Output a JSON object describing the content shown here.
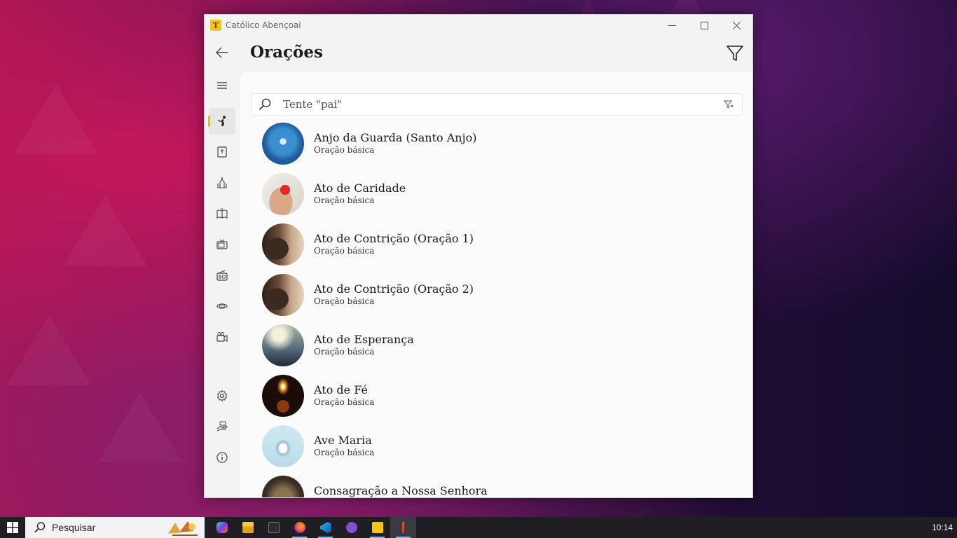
{
  "window": {
    "title": "Católico Abençoai"
  },
  "header": {
    "page_title": "Orações"
  },
  "search": {
    "placeholder": "Tente \"pai\""
  },
  "nav_rail": {
    "items": [
      {
        "name": "menu",
        "icon": "hamburger-icon"
      },
      {
        "name": "prayers",
        "icon": "praying-person-icon",
        "active": true
      },
      {
        "name": "bible",
        "icon": "bible-icon"
      },
      {
        "name": "church",
        "icon": "church-icon"
      },
      {
        "name": "liturgy",
        "icon": "book-icon"
      },
      {
        "name": "tv",
        "icon": "tv-icon"
      },
      {
        "name": "radio",
        "icon": "radio-icon"
      },
      {
        "name": "saints",
        "icon": "halo-icon"
      },
      {
        "name": "videos",
        "icon": "video-camera-icon"
      },
      {
        "name": "settings",
        "icon": "gear-icon"
      },
      {
        "name": "donate",
        "icon": "donate-hand-icon"
      },
      {
        "name": "about",
        "icon": "info-icon"
      }
    ]
  },
  "prayers": [
    {
      "title": "Anjo da Guarda (Santo Anjo)",
      "subtitle": "Oração básica"
    },
    {
      "title": "Ato de Caridade",
      "subtitle": "Oração básica"
    },
    {
      "title": "Ato de Contrição (Oração 1)",
      "subtitle": "Oração básica"
    },
    {
      "title": "Ato de Contrição (Oração 2)",
      "subtitle": "Oração básica"
    },
    {
      "title": "Ato de Esperança",
      "subtitle": "Oração básica"
    },
    {
      "title": "Ato de Fé",
      "subtitle": "Oração básica"
    },
    {
      "title": "Ave Maria",
      "subtitle": "Oração básica"
    },
    {
      "title": "Consagração a Nossa Senhora",
      "subtitle": ""
    }
  ],
  "taskbar": {
    "search_label": "Pesquisar",
    "clock": "10:14",
    "apps": [
      "copilot",
      "file-explorer",
      "terminal",
      "firefox",
      "vscode",
      "github-desktop",
      "catolico-abencoai",
      "app-running"
    ]
  },
  "colors": {
    "accent": "#f5b800",
    "window_bg": "#f3f3f3",
    "content_bg": "#fbfbfb"
  }
}
